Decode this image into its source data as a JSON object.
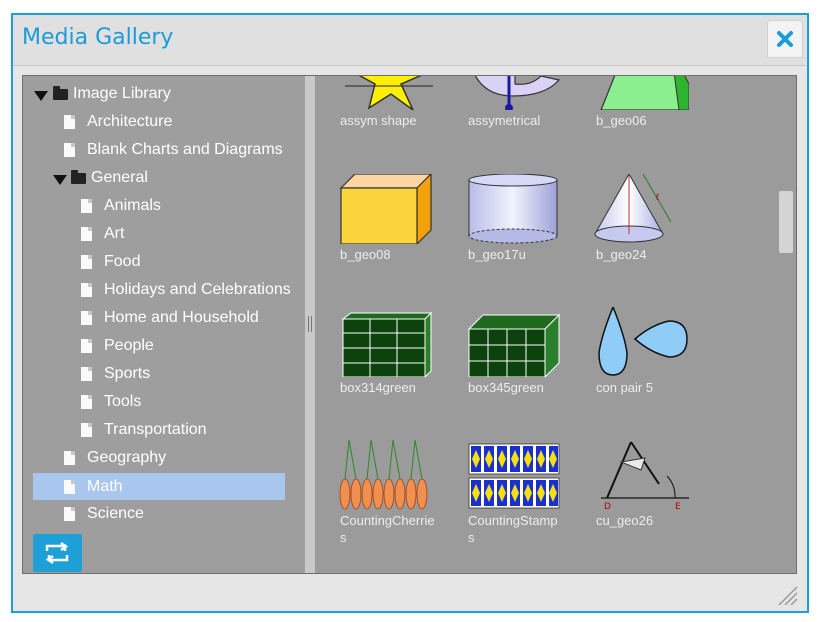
{
  "dialog": {
    "title": "Media Gallery",
    "close_icon": "close-x-icon",
    "accent_color": "#1ea0d6"
  },
  "tree": {
    "items": [
      {
        "label": "Image Library",
        "type": "folder",
        "expanded": true,
        "level": 0
      },
      {
        "label": "Architecture",
        "type": "file",
        "level": 1
      },
      {
        "label": "Blank Charts and Diagrams",
        "type": "file",
        "level": 1
      },
      {
        "label": "General",
        "type": "folder",
        "expanded": true,
        "level": 1
      },
      {
        "label": "Animals",
        "type": "file",
        "level": 2
      },
      {
        "label": "Art",
        "type": "file",
        "level": 2
      },
      {
        "label": "Food",
        "type": "file",
        "level": 2
      },
      {
        "label": "Holidays and Celebrations",
        "type": "file",
        "level": 2
      },
      {
        "label": "Home and Household",
        "type": "file",
        "level": 2
      },
      {
        "label": "People",
        "type": "file",
        "level": 2
      },
      {
        "label": "Sports",
        "type": "file",
        "level": 2
      },
      {
        "label": "Tools",
        "type": "file",
        "level": 2
      },
      {
        "label": "Transportation",
        "type": "file",
        "level": 2
      },
      {
        "label": "Geography",
        "type": "file",
        "level": 1
      },
      {
        "label": "Math",
        "type": "file",
        "level": 1,
        "selected": true
      },
      {
        "label": "Science",
        "type": "file",
        "level": 1
      }
    ],
    "refresh_icon": "refresh-icon",
    "selected_color": "#a9c6ee"
  },
  "gallery": {
    "items": [
      {
        "name": "assym shape",
        "icon": "star-shape-icon"
      },
      {
        "name": "assymetrical",
        "icon": "asymmetrical-shape-icon"
      },
      {
        "name": "b_geo06",
        "icon": "trapezoid-prism-icon"
      },
      {
        "name": "b_geo08",
        "icon": "cube-icon"
      },
      {
        "name": "b_geo17u",
        "icon": "cylinder-icon"
      },
      {
        "name": "b_geo24",
        "icon": "cone-icon"
      },
      {
        "name": "box314green",
        "icon": "green-box-icon"
      },
      {
        "name": "box345green",
        "icon": "green-box-icon"
      },
      {
        "name": "con pair 5",
        "icon": "drop-pair-icon"
      },
      {
        "name": "CountingCherries",
        "icon": "cherries-icon"
      },
      {
        "name": "CountingStamps",
        "icon": "stamps-icon"
      },
      {
        "name": "cu_geo26",
        "icon": "compass-icon"
      }
    ]
  }
}
